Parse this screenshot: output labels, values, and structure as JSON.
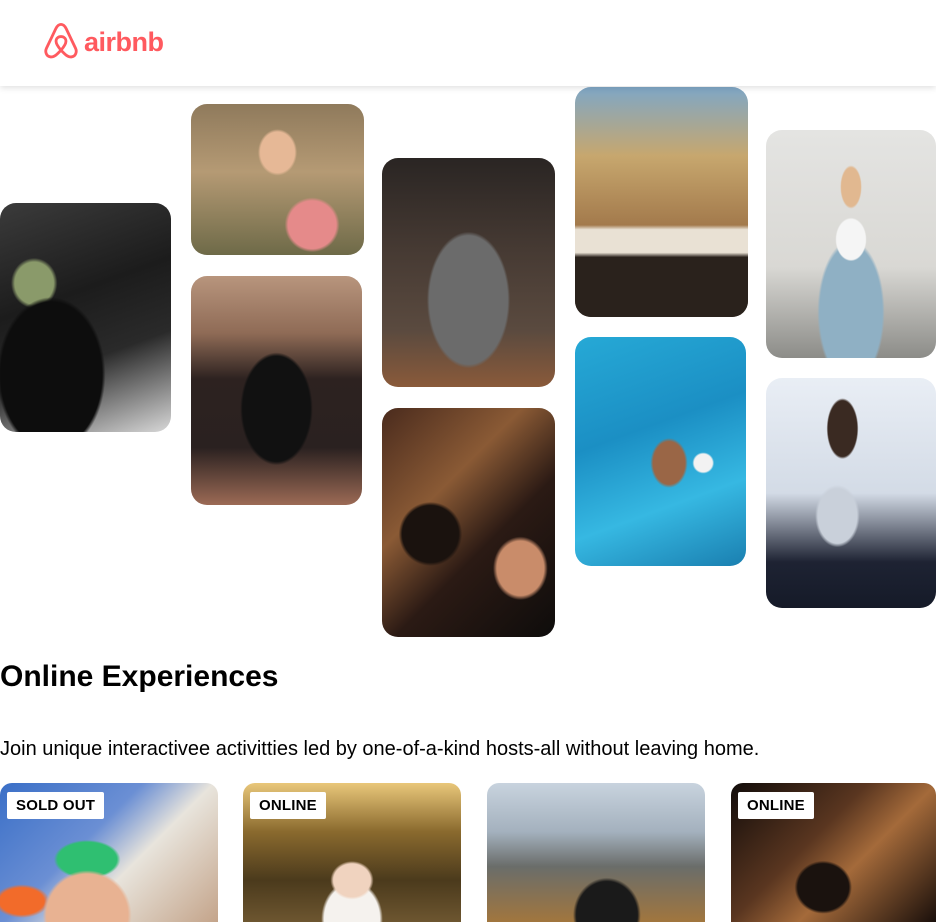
{
  "header": {
    "logo_text": "airbnb",
    "brand_color": "#ff5a5f"
  },
  "hero_photos": [
    {
      "subject": "cooking-pans"
    },
    {
      "subject": "woman-with-macarons"
    },
    {
      "subject": "dancer-in-doorway"
    },
    {
      "subject": "stone-bowl-food"
    },
    {
      "subject": "acoustic-guitar"
    },
    {
      "subject": "keyboard-microphone"
    },
    {
      "subject": "swimmer-pool"
    },
    {
      "subject": "yoga-meditation"
    },
    {
      "subject": "singer-microphone"
    }
  ],
  "section": {
    "title": "Online Experiences",
    "subtitle": "Join unique interactivee activitties led by one-of-a-kind hosts-all without leaving home."
  },
  "cards": [
    {
      "badge": "SOLD OUT"
    },
    {
      "badge": "ONLINE"
    },
    {
      "badge": ""
    },
    {
      "badge": "ONLINE"
    }
  ]
}
